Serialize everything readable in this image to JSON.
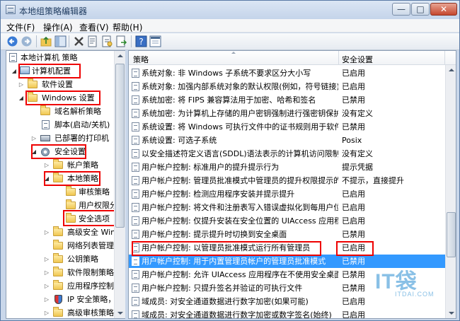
{
  "window": {
    "title": "本地组策略编辑器"
  },
  "window_controls": {
    "minimize": "—",
    "maximize": "□",
    "close": "✕"
  },
  "menu": [
    "文件(F)",
    "操作(A)",
    "查看(V)",
    "帮助(H)"
  ],
  "toolbar": {
    "icons": [
      "back-arrow-icon",
      "forward-arrow-icon",
      "up-folder-icon",
      "show-hide-tree-icon",
      "delete-icon",
      "properties-icon",
      "refresh-icon",
      "export-icon",
      "help-icon",
      "console-icon"
    ]
  },
  "tree": {
    "items": [
      {
        "label": "本地计算机 策略",
        "icon": "policy-icon",
        "expander": ""
      },
      {
        "label": "计算机配置",
        "icon": "computer-icon",
        "expander": "◢"
      },
      {
        "label": "软件设置",
        "icon": "folder-icon",
        "expander": "▷"
      },
      {
        "label": "Windows 设置",
        "icon": "folder-icon",
        "expander": "◢"
      },
      {
        "label": "域名解析策略",
        "icon": "folder-icon",
        "expander": ""
      },
      {
        "label": "脚本(启动/关机)",
        "icon": "doc-icon",
        "expander": ""
      },
      {
        "label": "已部署的打印机",
        "icon": "printer-icon",
        "expander": "▷"
      },
      {
        "label": "安全设置",
        "icon": "gear-icon",
        "expander": "◢"
      },
      {
        "label": "帐户策略",
        "icon": "folder-icon",
        "expander": "▷"
      },
      {
        "label": "本地策略",
        "icon": "folder-icon",
        "expander": "◢"
      },
      {
        "label": "审核策略",
        "icon": "folder-icon",
        "expander": ""
      },
      {
        "label": "用户权限分",
        "icon": "folder-icon",
        "expander": ""
      },
      {
        "label": "安全选项",
        "icon": "folder-icon",
        "expander": ""
      },
      {
        "label": "高级安全 Wind",
        "icon": "folder-icon",
        "expander": "▷"
      },
      {
        "label": "网络列表管理器",
        "icon": "folder-icon",
        "expander": ""
      },
      {
        "label": "公钥策略",
        "icon": "folder-icon",
        "expander": "▷"
      },
      {
        "label": "软件限制策略",
        "icon": "folder-icon",
        "expander": "▷"
      },
      {
        "label": "应用程序控制策",
        "icon": "folder-icon",
        "expander": "▷"
      },
      {
        "label": "IP 安全策略，在",
        "icon": "shield-icon",
        "expander": "▷"
      },
      {
        "label": "高级审核策略",
        "icon": "folder-icon",
        "expander": "▷"
      }
    ]
  },
  "list": {
    "columns": [
      "策略",
      "安全设置"
    ],
    "rows": [
      {
        "policy": "系统对象: 非 Windows 子系统不要求区分大小写",
        "setting": "已启用"
      },
      {
        "policy": "系统对象: 加强内部系统对象的默认权限(例如，符号链接)",
        "setting": "已启用"
      },
      {
        "policy": "系统加密: 将 FIPS 兼容算法用于加密、哈希和签名",
        "setting": "已禁用"
      },
      {
        "policy": "系统加密: 为计算机上存储的用户密钥强制进行强密钥保护",
        "setting": "没有定义"
      },
      {
        "policy": "系统设置: 将 Windows 可执行文件中的证书规则用于软件...",
        "setting": "已禁用"
      },
      {
        "policy": "系统设置: 可选子系统",
        "setting": "Posix"
      },
      {
        "policy": "以安全描述符定义语言(SDDL)语法表示的计算机访问限制",
        "setting": "没有定义"
      },
      {
        "policy": "用户帐户控制: 标准用户的提升提示行为",
        "setting": "提示凭据"
      },
      {
        "policy": "用户帐户控制: 管理员批准模式中管理员的提升权限提示的...",
        "setting": "不提示，直接提升"
      },
      {
        "policy": "用户帐户控制: 检测应用程序安装并提示提升",
        "setting": "已启用"
      },
      {
        "policy": "用户帐户控制: 将文件和注册表写入错误虚拟化到每用户位置",
        "setting": "已启用"
      },
      {
        "policy": "用户帐户控制: 仅提升安装在安全位置的 UIAccess 应用程序",
        "setting": "已启用"
      },
      {
        "policy": "用户帐户控制: 提示提升时切换到安全桌面",
        "setting": "已禁用"
      },
      {
        "policy": "用户帐户控制: 以管理员批准模式运行所有管理员",
        "setting": "已启用"
      },
      {
        "policy": "用户帐户控制: 用于内置管理员帐户的管理员批准模式",
        "setting": "已禁用"
      },
      {
        "policy": "用户帐户控制: 允许 UIAccess 应用程序在不使用安全桌面...",
        "setting": "已禁用"
      },
      {
        "policy": "用户帐户控制: 只提升签名并验证的可执行文件",
        "setting": "已禁用"
      },
      {
        "policy": "域成员: 对安全通道数据进行数字加密(如果可能)",
        "setting": "已启用"
      },
      {
        "policy": "域成员: 对安全通道数据进行数字加密或数字签名(始终)",
        "setting": "已启用"
      }
    ],
    "selected_index": 14
  },
  "watermark": {
    "logo": "IT袋",
    "sub": "ITDAI.COM"
  },
  "colors": {
    "selection": "#3399ff",
    "highlight_box": "#ee0000"
  }
}
